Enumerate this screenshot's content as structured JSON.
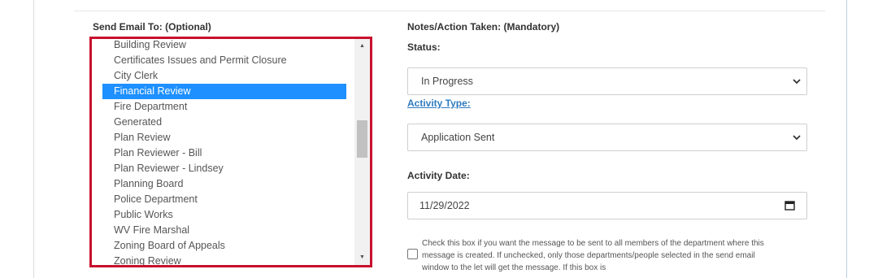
{
  "send_email": {
    "label": "Send Email To: (Optional)",
    "items": [
      {
        "label": "Building Review",
        "selected": false
      },
      {
        "label": "Certificates Issues and Permit Closure",
        "selected": false
      },
      {
        "label": "City Clerk",
        "selected": false
      },
      {
        "label": "Financial Review",
        "selected": true
      },
      {
        "label": "Fire Department",
        "selected": false
      },
      {
        "label": "Generated",
        "selected": false
      },
      {
        "label": "Plan Review",
        "selected": false
      },
      {
        "label": "Plan Reviewer - Bill",
        "selected": false
      },
      {
        "label": "Plan Reviewer - Lindsey",
        "selected": false
      },
      {
        "label": "Planning Board",
        "selected": false
      },
      {
        "label": "Police Department",
        "selected": false
      },
      {
        "label": "Public Works",
        "selected": false
      },
      {
        "label": "WV Fire Marshal",
        "selected": false
      },
      {
        "label": "Zoning Board of Appeals",
        "selected": false
      },
      {
        "label": "Zoning Review",
        "selected": false
      }
    ],
    "scroll_up_glyph": "▲",
    "scroll_down_glyph": "▼"
  },
  "notes": {
    "label": "Notes/Action Taken: (Mandatory)"
  },
  "status": {
    "label": "Status:",
    "value": "In Progress"
  },
  "activity_type": {
    "label": "Activity Type:",
    "value": "Application Sent"
  },
  "activity_date": {
    "label": "Activity Date:",
    "value": "11/29/2022"
  },
  "notify_all": {
    "checked": false,
    "text": "Check this box if you want the message to be sent to all members of the department where this message is created. If unchecked, only those departments/people selected in the send email window to the let will get the message. If this box is"
  },
  "colors": {
    "highlight_border": "#c8102e",
    "selected_item": "#1e90ff",
    "link": "#2f7bbf"
  }
}
